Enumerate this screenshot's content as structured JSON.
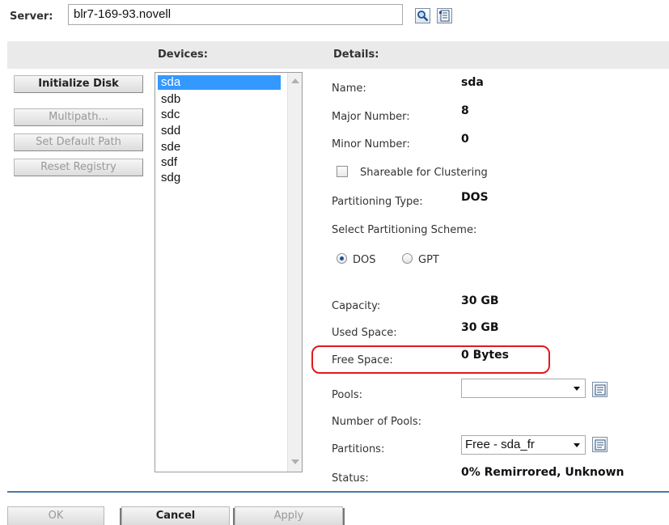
{
  "server": {
    "label": "Server:",
    "value": "blr7-169-93.novell",
    "search_icon": "magnifier-icon",
    "browse_icon": "tree-browse-icon"
  },
  "headers": {
    "devices": "Devices:",
    "details": "Details:"
  },
  "left_buttons": {
    "initialize": "Initialize Disk",
    "multipath": "Multipath...",
    "default_path": "Set Default Path",
    "reset_registry": "Reset Registry"
  },
  "devices": [
    "sda",
    "sdb",
    "sdc",
    "sdd",
    "sde",
    "sdf",
    "sdg"
  ],
  "selected_device": "sda",
  "details": {
    "name_label": "Name:",
    "name": "sda",
    "major_label": "Major Number:",
    "major": "8",
    "minor_label": "Minor Number:",
    "minor": "0",
    "shareable_label": "Shareable for Clustering",
    "shareable_checked": false,
    "ptype_label": "Partitioning Type:",
    "ptype": "DOS",
    "scheme_label": "Select Partitioning Scheme:",
    "scheme_options": [
      "DOS",
      "GPT"
    ],
    "scheme_selected": "DOS",
    "capacity_label": "Capacity:",
    "capacity": "30 GB",
    "used_label": "Used Space:",
    "used": "30 GB",
    "free_label": "Free Space:",
    "free": "0 Bytes",
    "pools_label": "Pools:",
    "pools_value": "",
    "num_pools_label": "Number of Pools:",
    "partitions_label": "Partitions:",
    "partitions_value": "Free - sda_fr",
    "status_label": "Status:",
    "status": "0% Remirrored, Unknown"
  },
  "highlight_color": "#e01a1a",
  "bottom_buttons": {
    "ok": "OK",
    "cancel": "Cancel",
    "apply": "Apply"
  }
}
